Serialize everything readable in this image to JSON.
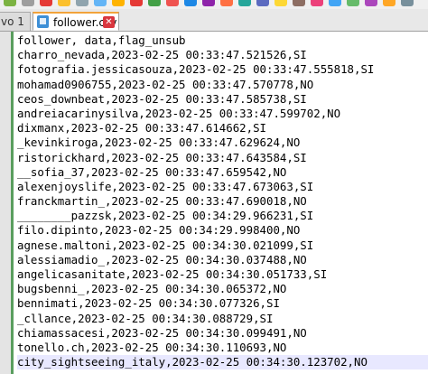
{
  "tabs": [
    {
      "label": "vo 1",
      "active": false,
      "icon": "file-icon"
    },
    {
      "label": "follower.csv",
      "active": true,
      "icon": "file-icon",
      "close_icon": "close-icon"
    }
  ],
  "editor": {
    "lines": [
      "follower, data,flag_unsub",
      "charro_nevada,2023-02-25 00:33:47.521526,SI",
      "fotografia.jessicasouza,2023-02-25 00:33:47.555818,SI",
      "mohamad0906755,2023-02-25 00:33:47.570778,NO",
      "ceos_downbeat,2023-02-25 00:33:47.585738,SI",
      "andreiacarinysilva,2023-02-25 00:33:47.599702,NO",
      "dixmanx,2023-02-25 00:33:47.614662,SI",
      "_kevinkiroga,2023-02-25 00:33:47.629624,NO",
      "ristorickhard,2023-02-25 00:33:47.643584,SI",
      "__sofia_37,2023-02-25 00:33:47.659542,NO",
      "alexenjoyslife,2023-02-25 00:33:47.673063,SI",
      "franckmartin_,2023-02-25 00:33:47.690018,NO",
      "________pazzsk,2023-02-25 00:34:29.966231,SI",
      "filo.dipinto,2023-02-25 00:34:29.998400,NO",
      "agnese.maltoni,2023-02-25 00:34:30.021099,SI",
      "alessiamadio_,2023-02-25 00:34:30.037488,NO",
      "angelicasanitate,2023-02-25 00:34:30.051733,SI",
      "bugsbenni_,2023-02-25 00:34:30.065372,NO",
      "bennimati,2023-02-25 00:34:30.077326,SI",
      "_cllance,2023-02-25 00:34:30.088729,SI",
      "chiamassacesi,2023-02-25 00:34:30.099491,NO",
      "tonello.ch,2023-02-25 00:34:30.110693,NO",
      "city_sightseeing_italy,2023-02-25 00:34:30.123702,NO"
    ],
    "current_line": 22
  },
  "colors": {
    "active_tab_accent": "#f2a33a",
    "close_button": "#d9363e",
    "fold_margin": "#5a9e5e",
    "current_line_highlight": "#e8e8ff"
  }
}
